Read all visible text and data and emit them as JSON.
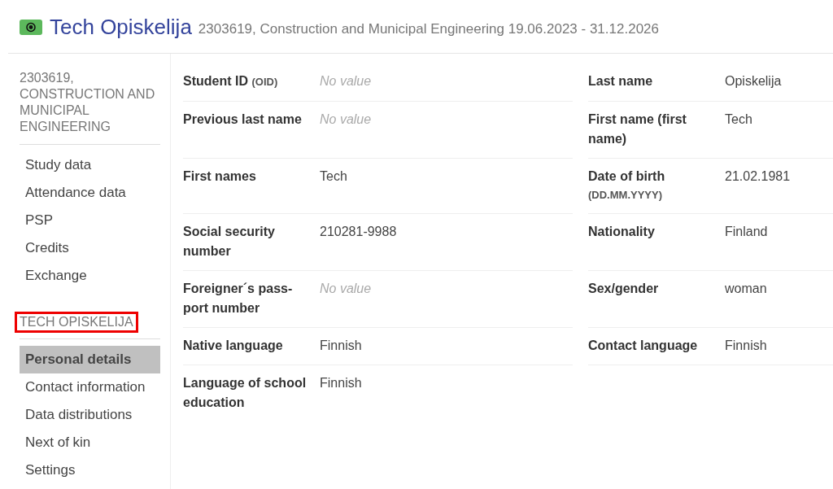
{
  "header": {
    "title": "Tech Opiskelija",
    "subtitle": "2303619, Construction and Municipal Engineering 19.06.2023 - 31.12.2026"
  },
  "sidebar": {
    "sections": [
      {
        "heading": "2303619, CONSTRUCTION AND MUNICIPAL ENGINEERING",
        "highlighted": false,
        "items": [
          {
            "label": "Study data",
            "selected": false
          },
          {
            "label": "Attendance data",
            "selected": false
          },
          {
            "label": "PSP",
            "selected": false
          },
          {
            "label": "Credits",
            "selected": false
          },
          {
            "label": "Exchange",
            "selected": false
          }
        ]
      },
      {
        "heading": "TECH OPISKELIJA",
        "highlighted": true,
        "items": [
          {
            "label": "Personal details",
            "selected": true
          },
          {
            "label": "Contact information",
            "selected": false
          },
          {
            "label": "Data distributions",
            "selected": false
          },
          {
            "label": "Next of kin",
            "selected": false
          },
          {
            "label": "Settings",
            "selected": false
          }
        ]
      }
    ]
  },
  "details": {
    "left": [
      {
        "label": "Student ID",
        "note": "(OID)",
        "value": "No value",
        "missing": true
      },
      {
        "label": "Previous last name",
        "value": "No value",
        "missing": true
      },
      {
        "label": "First names",
        "value": "Tech",
        "missing": false
      },
      {
        "label": "Social security number",
        "value": "210281-9988",
        "missing": false
      },
      {
        "label": "Foreigner´s pass-port number",
        "value": "No value",
        "missing": true
      },
      {
        "label": "Native language",
        "value": "Finnish",
        "missing": false
      },
      {
        "label": "Language of school education",
        "value": "Finnish",
        "missing": false
      }
    ],
    "right": [
      {
        "label": "Last name",
        "value": "Opiskelija",
        "missing": false
      },
      {
        "label": "First name (first name)",
        "value": "Tech",
        "missing": false
      },
      {
        "label": "Date of birth",
        "note": "(DD.MM.YYYY)",
        "value": "21.02.1981",
        "missing": false
      },
      {
        "label": "Nationality",
        "value": "Finland",
        "missing": false
      },
      {
        "label": "Sex/gender",
        "value": "woman",
        "missing": false
      },
      {
        "label": "Contact language",
        "value": "Finnish",
        "missing": false
      }
    ]
  }
}
